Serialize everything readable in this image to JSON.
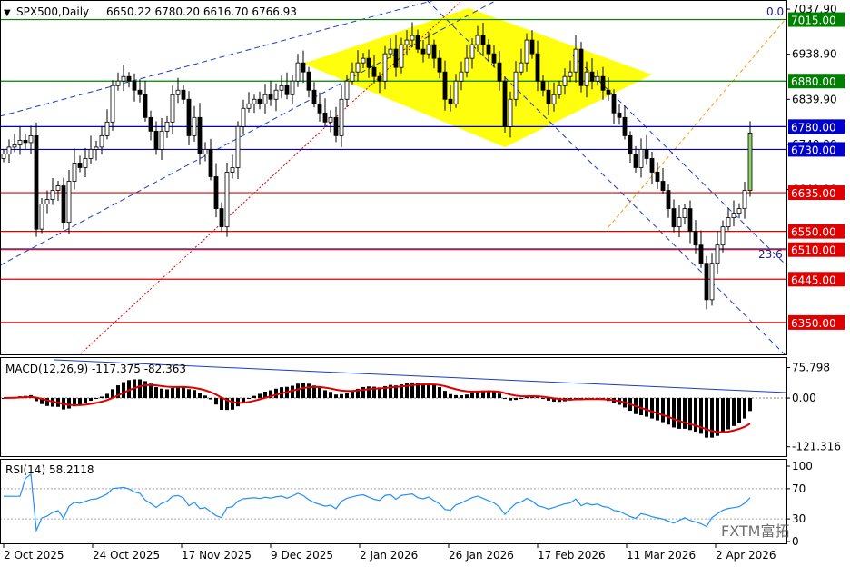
{
  "chart_data": {
    "type": "candlestick",
    "symbol_label": "SPX500,Daily",
    "ohlc_label": "6650.22 6780.20 6616.70 6766.93",
    "price_axis": {
      "range": [
        6280,
        7050
      ],
      "ticks": [
        {
          "label": "7037.90",
          "value": 7037.9
        },
        {
          "label": "6938.90",
          "value": 6938.9
        },
        {
          "label": "6839.90",
          "value": 6839.9
        },
        {
          "label": "6740.90",
          "value": 6740.9
        },
        {
          "label": "6641.90",
          "value": 6641.9
        }
      ]
    },
    "level_lines": [
      {
        "label": "7015.00",
        "value": 7015,
        "color": "#008000"
      },
      {
        "label": "6880.00",
        "value": 6880,
        "color": "#008000"
      },
      {
        "label": "6780.00",
        "value": 6780,
        "color": "#0000cc"
      },
      {
        "label": "6730.00",
        "value": 6730,
        "color": "#0000cc"
      },
      {
        "label": "6635.00",
        "value": 6635,
        "color": "#e00000"
      },
      {
        "label": "6550.00",
        "value": 6550,
        "color": "#e00000"
      },
      {
        "label": "6510.00",
        "value": 6510,
        "color": "#e00000"
      },
      {
        "label": "6445.00",
        "value": 6445,
        "color": "#e00000"
      },
      {
        "label": "6350.00",
        "value": 6350,
        "color": "#e00000"
      }
    ],
    "fib_labels": {
      "zero": "0.0",
      "level_23_6": "23.6"
    },
    "fib_level_23_6_value": 6512,
    "current_price": 6766.93,
    "x_axis_labels": [
      "2 Oct 2025",
      "24 Oct 2025",
      "17 Nov 2025",
      "9 Dec 2025",
      "2 Jan 2026",
      "26 Jan 2026",
      "17 Feb 2026",
      "11 Mar 2026",
      "2 Apr 2026"
    ],
    "candles_close": [
      6720,
      6735,
      6740,
      6750,
      6745,
      6760,
      6555,
      6610,
      6620,
      6640,
      6650,
      6570,
      6660,
      6700,
      6690,
      6710,
      6730,
      6735,
      6760,
      6790,
      6870,
      6880,
      6890,
      6880,
      6860,
      6850,
      6800,
      6770,
      6730,
      6770,
      6790,
      6850,
      6860,
      6840,
      6760,
      6800,
      6720,
      6730,
      6670,
      6600,
      6560,
      6680,
      6690,
      6780,
      6820,
      6830,
      6840,
      6830,
      6850,
      6840,
      6860,
      6870,
      6850,
      6880,
      6920,
      6900,
      6860,
      6830,
      6810,
      6790,
      6800,
      6760,
      6840,
      6880,
      6900,
      6920,
      6930,
      6910,
      6890,
      6880,
      6940,
      6950,
      6910,
      6960,
      6970,
      6980,
      6950,
      6940,
      6960,
      6930,
      6900,
      6840,
      6830,
      6880,
      6900,
      6930,
      6960,
      6980,
      6960,
      6940,
      6920,
      6880,
      6780,
      6840,
      6900,
      6920,
      6970,
      6940,
      6880,
      6860,
      6830,
      6850,
      6870,
      6890,
      6900,
      6950,
      6870,
      6900,
      6880,
      6890,
      6860,
      6850,
      6810,
      6800,
      6760,
      6720,
      6690,
      6730,
      6710,
      6680,
      6660,
      6640,
      6600,
      6560,
      6580,
      6600,
      6550,
      6520,
      6480,
      6400,
      6480,
      6520,
      6560,
      6580,
      6590,
      6600,
      6640,
      6766
    ],
    "indicators": {
      "macd": {
        "label": "MACD(12,26,9) -117.375 -82.363",
        "axis_ticks": [
          {
            "label": "75.798",
            "value": 75.798
          },
          {
            "label": "0.00",
            "value": 0
          },
          {
            "label": "-121.316",
            "value": -121.316
          }
        ],
        "range": [
          -140,
          95
        ]
      },
      "rsi": {
        "label": "RSI(14) 58.2118",
        "axis_ticks": [
          {
            "label": "100",
            "value": 100
          },
          {
            "label": "70",
            "value": 70
          },
          {
            "label": "30",
            "value": 30
          },
          {
            "label": "0",
            "value": 0
          }
        ],
        "current": 58.2118
      }
    },
    "watermark": "FXTM富拓"
  }
}
